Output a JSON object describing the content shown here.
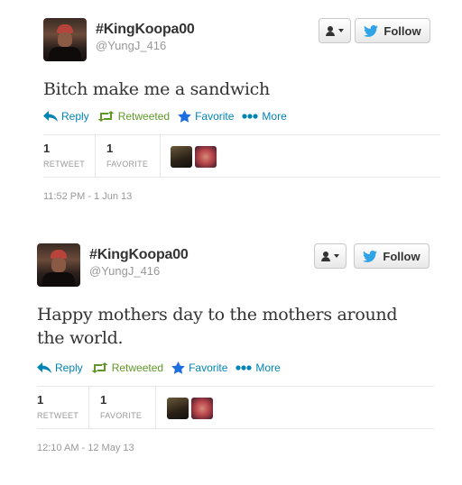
{
  "tweets": [
    {
      "fullname": "#KingKoopa00",
      "screen_name": "@YungJ_416",
      "follow_label": "Follow",
      "text": "Bitch make me a sandwich",
      "actions": {
        "reply": "Reply",
        "retweet": "Retweeted",
        "favorite": "Favorite",
        "more": "More"
      },
      "stats": {
        "retweets": "1",
        "retweet_label": "RETWEET",
        "favorites": "1",
        "favorite_label": "FAVORITE"
      },
      "timestamp": "11:52 PM - 1 Jun 13"
    },
    {
      "fullname": "#KingKoopa00",
      "screen_name": "@YungJ_416",
      "follow_label": "Follow",
      "text_line1": "Happy mothers day to the mothers around",
      "text_line2": "the world.",
      "actions": {
        "reply": "Reply",
        "retweet": "Retweeted",
        "favorite": "Favorite",
        "more": "More"
      },
      "stats": {
        "retweets": "1",
        "retweet_label": "RETWEET",
        "favorites": "1",
        "favorite_label": "FAVORITE"
      },
      "timestamp": "12:10 AM - 12 May 13"
    }
  ],
  "colors": {
    "link": "#0084b4",
    "retweeted": "#609928",
    "favorite": "#1d6fe0",
    "muted": "#999999"
  },
  "icons": [
    "reply-icon",
    "retweet-icon",
    "star-icon",
    "more-dots-icon",
    "user-icon",
    "bird-icon"
  ]
}
